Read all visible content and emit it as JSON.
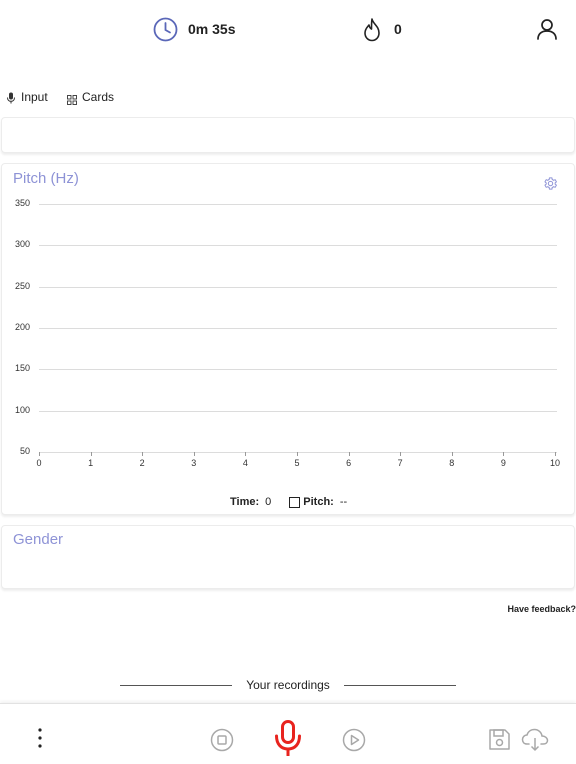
{
  "header": {
    "timer_value": "0m 35s",
    "streak_value": "0",
    "logo_icon": "waveform-logo-icon",
    "timer_icon": "clock-icon",
    "streak_icon": "flame-icon",
    "profile_icon": "user-icon"
  },
  "tabs": [
    {
      "label": "Input",
      "icon": "microphone-icon"
    },
    {
      "label": "Cards",
      "icon": "grid-icon"
    }
  ],
  "pitch_card": {
    "title": "Pitch (Hz)",
    "settings_icon": "gear-icon",
    "time_label": "Time:",
    "time_value": "0",
    "pitch_label": "Pitch:",
    "pitch_value": "--"
  },
  "chart_data": {
    "type": "line",
    "title": "Pitch (Hz)",
    "xlabel": "",
    "ylabel": "",
    "x_ticks": [
      "0",
      "1",
      "2",
      "3",
      "4",
      "5",
      "6",
      "7",
      "8",
      "9",
      "10"
    ],
    "y_ticks": [
      "350",
      "300",
      "250",
      "200",
      "150",
      "100",
      "50"
    ],
    "xlim": [
      0,
      10
    ],
    "ylim": [
      50,
      350
    ],
    "grid": true,
    "series": []
  },
  "gender_card": {
    "title": "Gender"
  },
  "feedback_link": "Have feedback?",
  "recordings_heading": "Your recordings",
  "bottom_bar": {
    "menu_icon": "more-vertical-icon",
    "stop_icon": "stop-icon",
    "record_icon": "microphone-icon",
    "play_icon": "play-icon",
    "save_icon": "save-icon",
    "download_icon": "cloud-download-icon",
    "accent_color": "#e8231e"
  },
  "colors": {
    "accent": "#8e93d6",
    "clock": "#5a67b8",
    "record": "#e8231e"
  }
}
